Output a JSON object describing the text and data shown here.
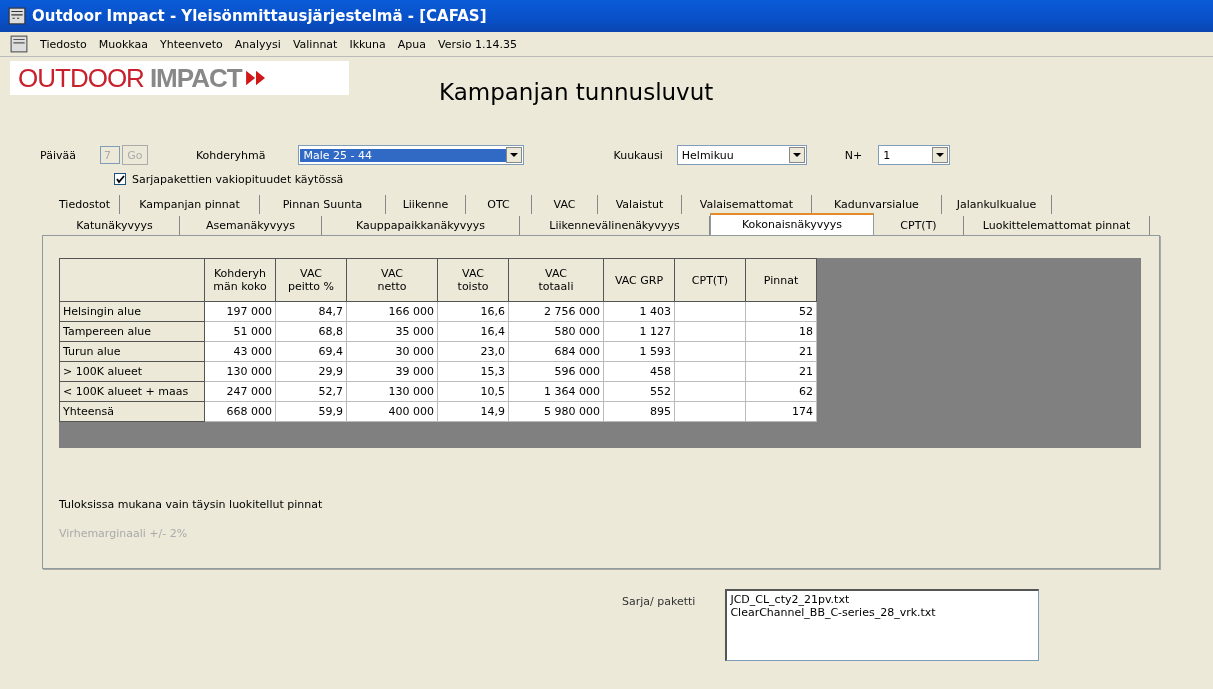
{
  "window": {
    "title": "Outdoor Impact - Yleisönmittausjärjestelmä - [CAFAS]"
  },
  "menu": [
    "Tiedosto",
    "Muokkaa",
    "Yhteenveto",
    "Analyysi",
    "Valinnat",
    "Ikkuna",
    "Apua",
    "Versio 1.14.35"
  ],
  "logo": {
    "word_1": "OUTDOOR",
    "word_2": "IMPACT"
  },
  "heading": "Kampanjan tunnusluvut",
  "filters": {
    "day": {
      "label": "Päivää",
      "value": "7",
      "disabled": true
    },
    "go_button": {
      "label": "Go",
      "disabled": true
    },
    "target_group": {
      "label": "Kohderyhmä",
      "value": "Male 25 - 44"
    },
    "month": {
      "label": "Kuukausi",
      "value": "Helmikuu"
    },
    "n_plus": {
      "label": "N+",
      "value": "1"
    },
    "checkbox": {
      "label": "Sarjapakettien vakiopituudet käytössä",
      "checked": true
    }
  },
  "tab_rows": [
    [
      {
        "label": "Tiedostot",
        "selected": false
      },
      {
        "label": "Kampanjan pinnat",
        "selected": false
      },
      {
        "label": "Pinnan Suunta",
        "selected": false
      },
      {
        "label": "Liikenne",
        "selected": false
      },
      {
        "label": "OTC",
        "selected": false
      },
      {
        "label": "VAC",
        "selected": false
      },
      {
        "label": "Valaistut",
        "selected": false
      },
      {
        "label": "Valaisemattomat",
        "selected": false
      },
      {
        "label": "Kadunvarsialue",
        "selected": false
      },
      {
        "label": "Jalankulkualue",
        "selected": false
      }
    ],
    [
      {
        "label": "Katunäkyvyys",
        "selected": false
      },
      {
        "label": "Asemanäkyvyys",
        "selected": false
      },
      {
        "label": "Kauppapaikkanäkyvyys",
        "selected": false
      },
      {
        "label": "Liikennevälinenäkyvyys",
        "selected": false
      },
      {
        "label": "Kokonaisnäkyvyys",
        "selected": true
      },
      {
        "label": "CPT(T)",
        "selected": false
      },
      {
        "label": "Luokittelemattomat pinnat",
        "selected": false
      }
    ]
  ],
  "table": {
    "columns": [
      "Kohderyh män koko",
      "VAC peitto %",
      "VAC netto",
      "VAC toisto",
      "VAC totaali",
      "VAC GRP",
      "CPT(T)",
      "Pinnat"
    ],
    "rows": [
      {
        "label": "Helsingin alue",
        "cells": [
          "197 000",
          "84,7",
          "166 000",
          "16,6",
          "2 756 000",
          "1 403",
          "",
          "52"
        ]
      },
      {
        "label": "Tampereen alue",
        "cells": [
          "51 000",
          "68,8",
          "35 000",
          "16,4",
          "580 000",
          "1 127",
          "",
          "18"
        ]
      },
      {
        "label": "Turun alue",
        "cells": [
          "43 000",
          "69,4",
          "30 000",
          "23,0",
          "684 000",
          "1 593",
          "",
          "21"
        ]
      },
      {
        "label": "> 100K alueet",
        "cells": [
          "130 000",
          "29,9",
          "39 000",
          "15,3",
          "596 000",
          "458",
          "",
          "21"
        ]
      },
      {
        "label": "< 100K alueet + maas",
        "cells": [
          "247 000",
          "52,7",
          "130 000",
          "10,5",
          "1 364 000",
          "552",
          "",
          "62"
        ]
      },
      {
        "label": "Yhteensä",
        "cells": [
          "668 000",
          "59,9",
          "400 000",
          "14,9",
          "5 980 000",
          "895",
          "",
          "174"
        ]
      }
    ]
  },
  "note": "Tuloksissa mukana vain täysin luokitellut pinnat",
  "margin_note": "Virhemarginaali +/- 2%",
  "package": {
    "label": "Sarja/ paketti",
    "items": [
      "JCD_CL_cty2_21pv.txt",
      "ClearChannel_BB_C-series_28_vrk.txt"
    ]
  }
}
